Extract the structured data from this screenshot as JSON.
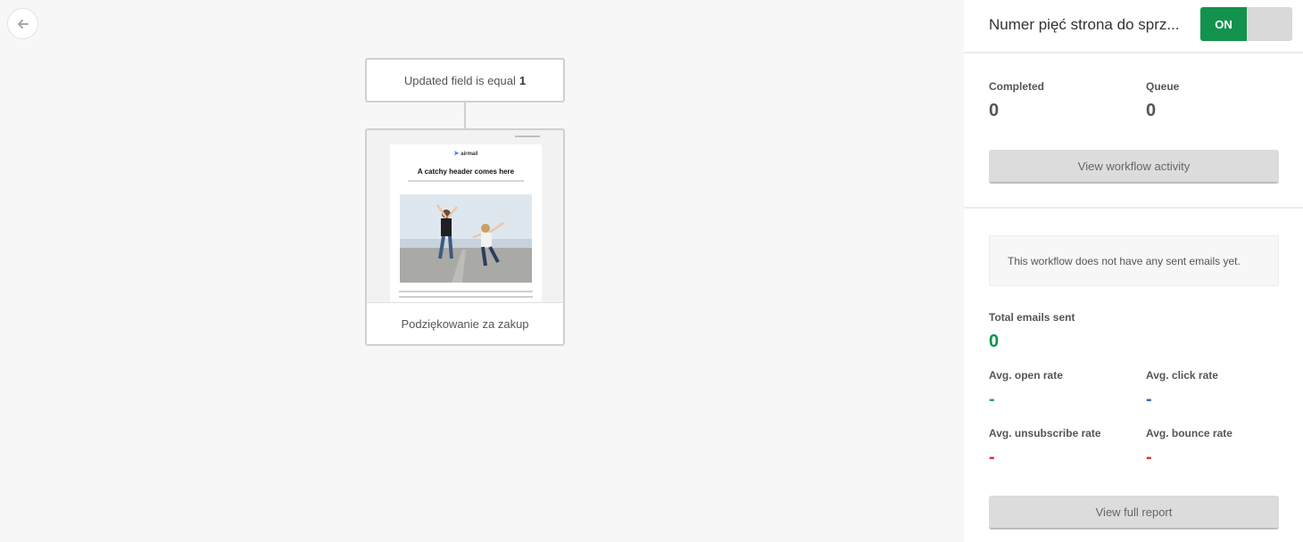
{
  "canvas": {
    "back_icon": "arrow-left-icon",
    "trigger": {
      "text": "Updated field is equal",
      "value": "1"
    },
    "email_node": {
      "label": "Podziękowanie za zakup",
      "preview": {
        "brand": "airmail",
        "header": "A catchy header comes here"
      }
    }
  },
  "panel": {
    "title": "Numer pięć strona do sprz...",
    "toggle": {
      "on_label": "ON",
      "state": "on"
    },
    "completed": {
      "label": "Completed",
      "value": "0"
    },
    "queue": {
      "label": "Queue",
      "value": "0"
    },
    "activity_button": "View workflow activity",
    "notice": "This workflow does not have any sent emails yet.",
    "total_sent": {
      "label": "Total emails sent",
      "value": "0"
    },
    "open_rate": {
      "label": "Avg. open rate",
      "value": "-"
    },
    "click_rate": {
      "label": "Avg. click rate",
      "value": "-"
    },
    "unsub_rate": {
      "label": "Avg. unsubscribe rate",
      "value": "-"
    },
    "bounce_rate": {
      "label": "Avg. bounce rate",
      "value": "-"
    },
    "report_button": "View full report"
  },
  "colors": {
    "accent_green": "#12924d",
    "teal": "#12a594",
    "blue": "#2f6fb0",
    "red": "#d93030"
  }
}
